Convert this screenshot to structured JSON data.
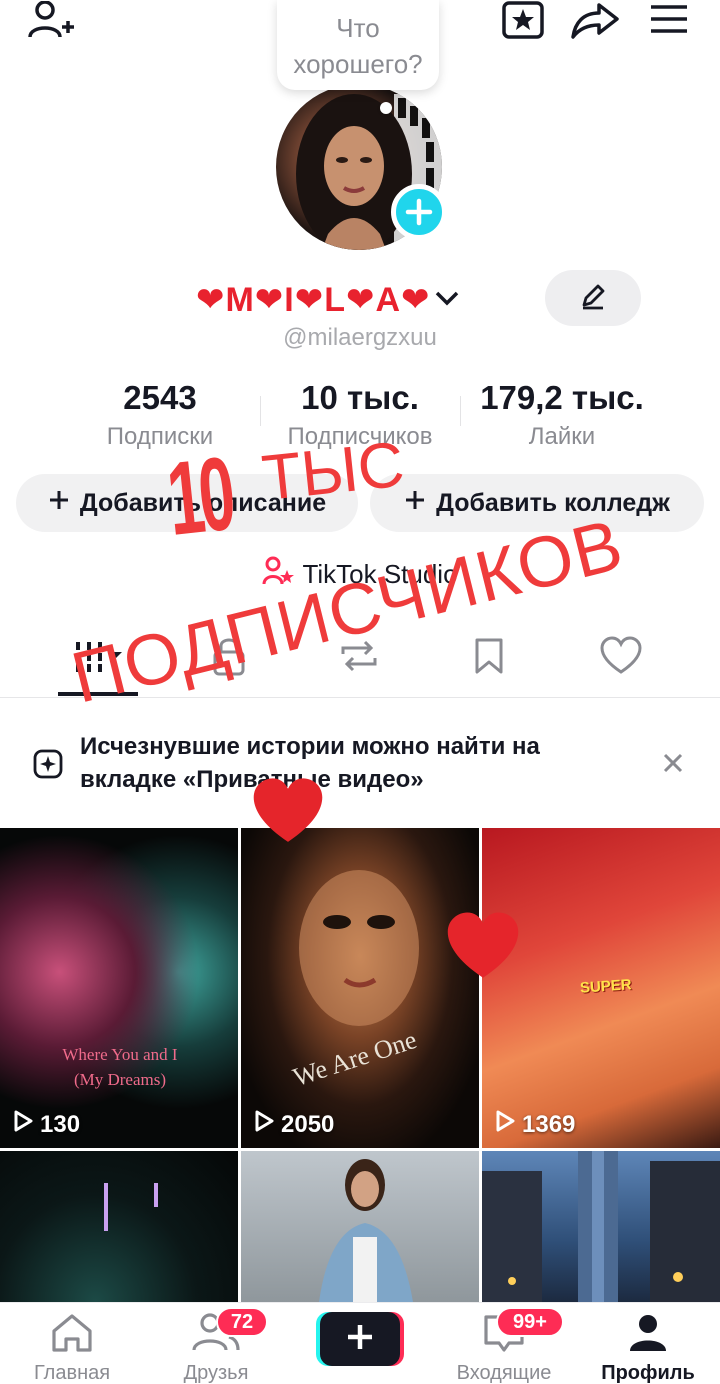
{
  "top_bubble": {
    "text": "Что хорошего?"
  },
  "profile": {
    "nickname": "❤M❤I❤L❤A❤",
    "username": "@milaergzxuu"
  },
  "stats": [
    {
      "value": "2543",
      "label": "Подписки"
    },
    {
      "value": "10 тыс.",
      "label": "Подписчиков"
    },
    {
      "value": "179,2 тыс.",
      "label": "Лайки"
    }
  ],
  "actions": {
    "add_description": "Добавить описание",
    "add_college": "Добавить колледж",
    "studio": "TikTok Studio"
  },
  "notice": {
    "text": "Исчезнувшие истории можно найти на вкладке «Приватные видео»"
  },
  "videos": [
    {
      "views": "130",
      "caption": "Where You and I (My Dreams)"
    },
    {
      "views": "2050",
      "caption": "We Are One"
    },
    {
      "views": "1369",
      "caption": "SUPER"
    },
    {
      "views": ""
    },
    {
      "views": ""
    },
    {
      "views": ""
    }
  ],
  "bottom_nav": {
    "home": "Главная",
    "friends": "Друзья",
    "friends_badge": "72",
    "inbox": "Входящие",
    "inbox_badge": "99+",
    "profile": "Профиль"
  },
  "overlay": {
    "line1_number": "10",
    "line1_word": "ТЫС",
    "line2": "ПОДПИСЧИКОВ"
  },
  "colors": {
    "accent_red": "#fe2c55",
    "accent_cyan": "#20d5ec",
    "overlay_red": "#ef3b3b"
  }
}
